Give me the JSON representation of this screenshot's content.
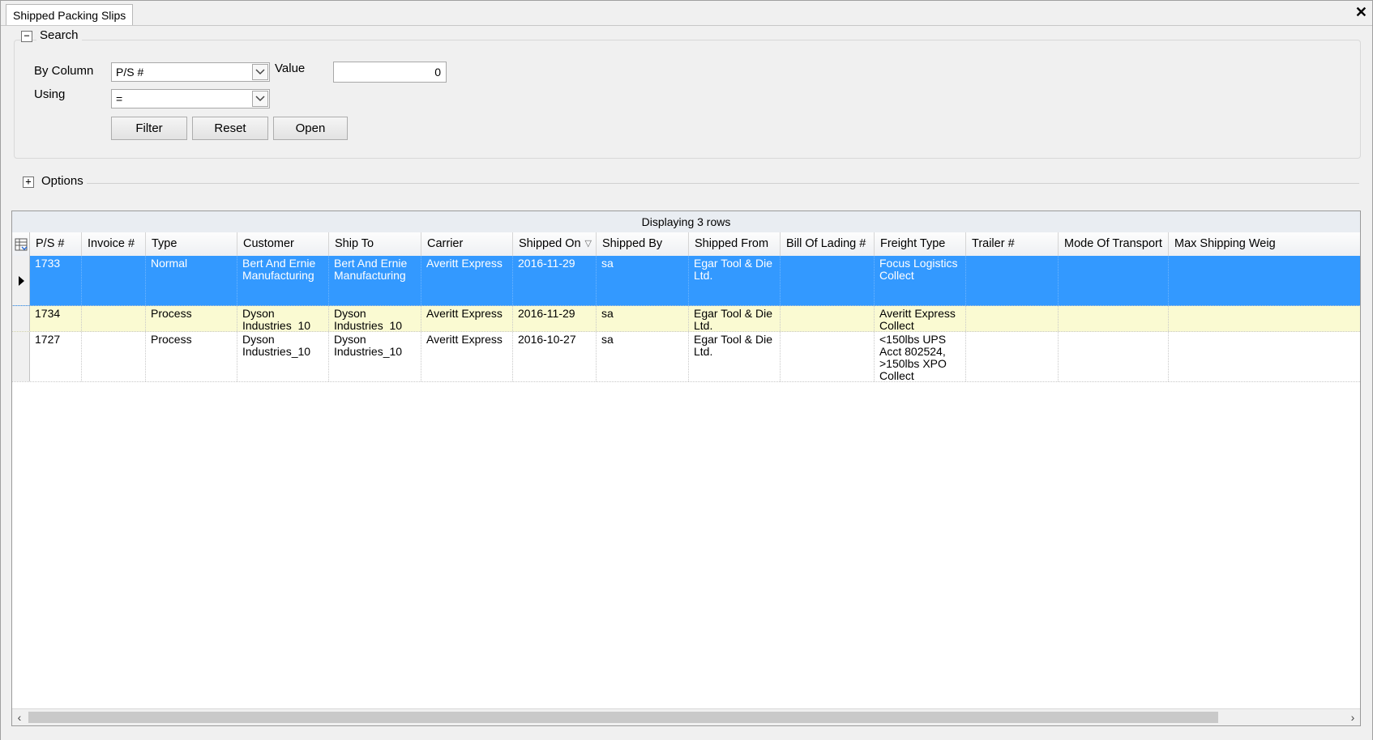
{
  "window": {
    "tab_title": "Shipped Packing Slips",
    "close_glyph": "✕"
  },
  "search": {
    "title": "Search",
    "by_column_label": "By Column",
    "by_column_value": "P/S #",
    "value_label": "Value",
    "value": "0",
    "using_label": "Using",
    "using_value": "=",
    "filter_label": "Filter",
    "reset_label": "Reset",
    "open_label": "Open"
  },
  "options": {
    "title": "Options"
  },
  "grid": {
    "caption": "Displaying 3 rows",
    "columns": [
      "P/S #",
      "Invoice #",
      "Type",
      "Customer",
      "Ship To",
      "Carrier",
      "Shipped On",
      "Shipped By",
      "Shipped From",
      "Bill Of Lading #",
      "Freight Type",
      "Trailer #",
      "Mode Of Transport",
      "Max Shipping Weig"
    ],
    "rows": [
      [
        "1733",
        "",
        "Normal",
        "Bert And Ernie Manufacturing",
        "Bert And Ernie Manufacturing",
        "Averitt Express",
        "2016-11-29",
        "sa",
        "Egar Tool & Die Ltd.",
        "",
        "Focus Logistics Collect",
        "",
        "",
        ""
      ],
      [
        "1734",
        "",
        "Process",
        "Dyson Industries_10",
        "Dyson Industries_10",
        "Averitt Express",
        "2016-11-29",
        "sa",
        "Egar Tool & Die Ltd.",
        "",
        "Averitt Express Collect",
        "",
        "",
        ""
      ],
      [
        "1727",
        "",
        "Process",
        "Dyson Industries_10",
        "Dyson Industries_10",
        "Averitt Express",
        "2016-10-27",
        "sa",
        "Egar Tool & Die Ltd.",
        "",
        "<150lbs UPS Acct 802524, >150lbs XPO Collect",
        "",
        "",
        ""
      ]
    ]
  },
  "colors": {
    "selection": "#3399ff",
    "alt_row": "#fafad2"
  },
  "icons": [
    "collapse-icon",
    "expand-icon",
    "dropdown-arrow-icon",
    "column-chooser-icon",
    "sort-descending-icon",
    "row-pointer-icon",
    "scroll-left-icon",
    "scroll-right-icon",
    "close-icon"
  ]
}
